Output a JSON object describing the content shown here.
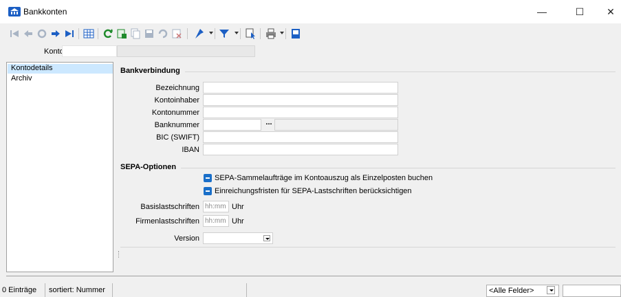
{
  "window": {
    "title": "Bankkonten",
    "minimize_glyph": "—",
    "maximize_glyph": "☐",
    "close_glyph": "✕"
  },
  "toolbar": {
    "icons": [
      "first-record-icon",
      "previous-record-icon",
      "undo-icon",
      "next-record-icon",
      "last-record-icon",
      "table-view-icon",
      "refresh-icon",
      "new-record-icon",
      "copy-record-icon",
      "save-record-icon",
      "undo-changes-icon",
      "delete-record-icon",
      "pin-icon",
      "filter-icon",
      "select-icon",
      "print-icon",
      "exit-icon"
    ],
    "colors": {
      "navigation_blue": "#1c5fc4",
      "refresh_green": "#1f8a2b",
      "disabled_gray": "#a8b4c4"
    }
  },
  "konto": {
    "label": "Konto",
    "value": ""
  },
  "tree": {
    "items": [
      {
        "label": "Kontodetails",
        "selected": true
      },
      {
        "label": "Archiv",
        "selected": false
      }
    ]
  },
  "bankverbindung": {
    "title": "Bankverbindung",
    "fields": {
      "bezeichnung": {
        "label": "Bezeichnung",
        "value": ""
      },
      "kontoinhaber": {
        "label": "Kontoinhaber",
        "value": ""
      },
      "kontonummer": {
        "label": "Kontonummer",
        "value": ""
      },
      "banknummer": {
        "label": "Banknummer",
        "value": "",
        "button": "..."
      },
      "bic": {
        "label": "BIC (SWIFT)",
        "value": ""
      },
      "iban": {
        "label": "IBAN",
        "value": ""
      }
    }
  },
  "sepa": {
    "title": "SEPA-Optionen",
    "option1": "SEPA-Sammelaufträge im Kontoauszug als Einzelposten buchen",
    "option2": "Einreichungsfristen für SEPA-Lastschriften berücksichtigen",
    "basislastschriften": {
      "label": "Basislastschriften",
      "placeholder": "hh:mm",
      "unit": "Uhr"
    },
    "firmenlastschriften": {
      "label": "Firmenlastschriften",
      "placeholder": "hh:mm",
      "unit": "Uhr"
    },
    "version": {
      "label": "Version",
      "value": ""
    }
  },
  "status": {
    "count": "0 Einträge",
    "sort": "sortiert: Nummer",
    "filter": "<Alle Felder>"
  }
}
